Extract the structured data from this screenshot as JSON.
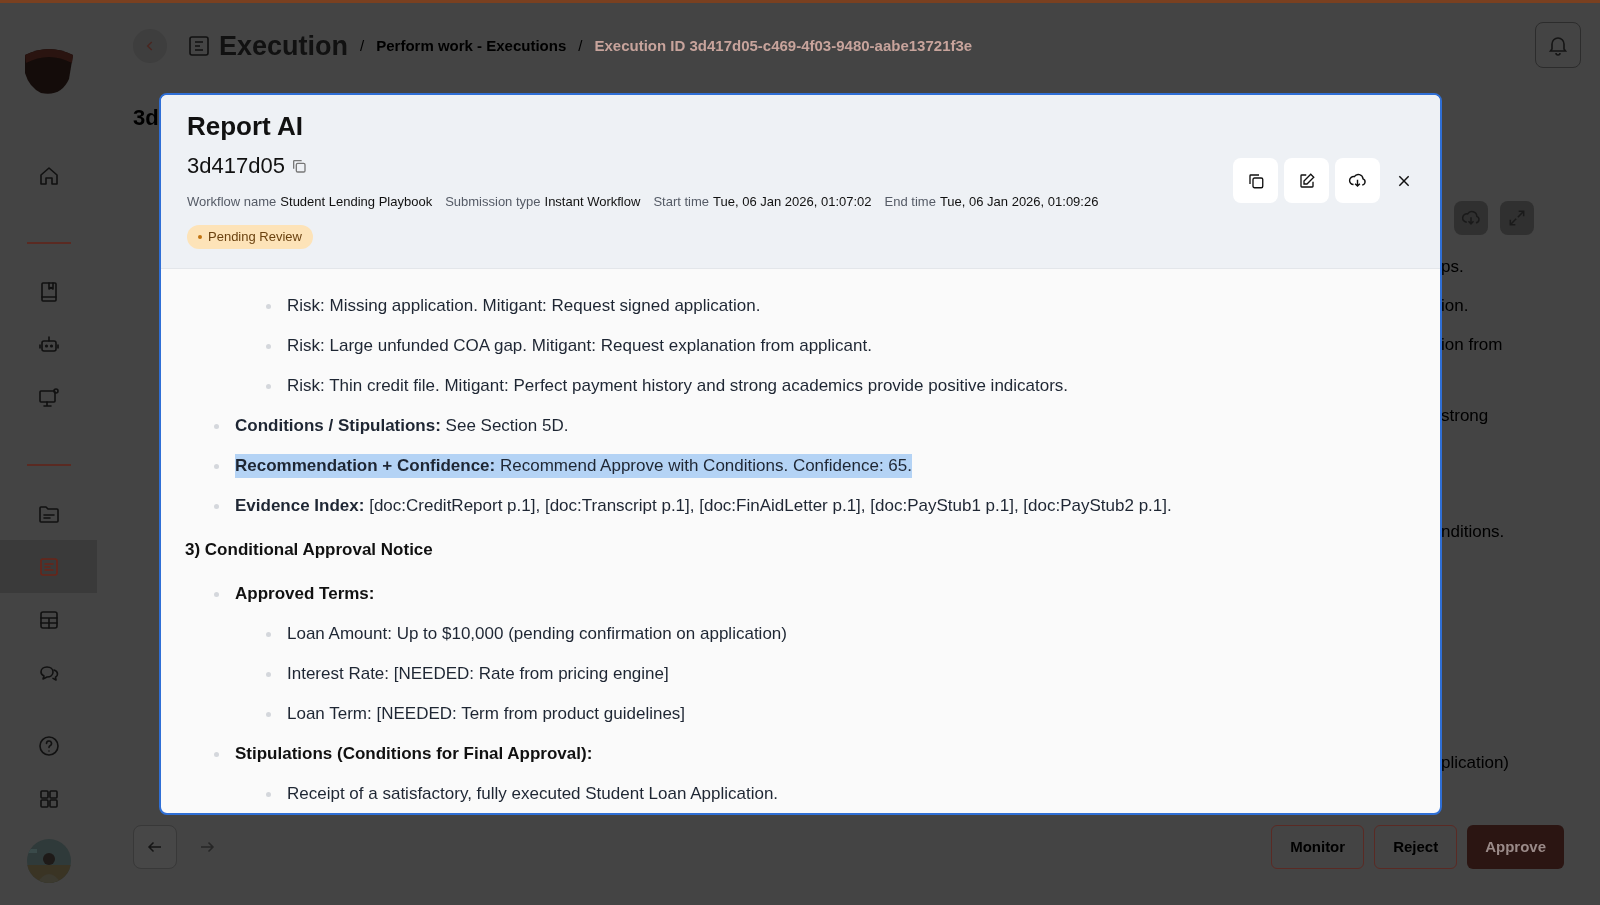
{
  "sidebar": {
    "items": [
      {
        "selected": false
      },
      {
        "selected": false
      },
      {
        "selected": false
      },
      {
        "selected": false
      },
      {
        "selected": false
      },
      {
        "selected": true
      },
      {
        "selected": false
      },
      {
        "selected": false
      },
      {
        "selected": false
      },
      {
        "selected": false
      }
    ]
  },
  "breadcrumb": {
    "title": "Execution",
    "separator": "/",
    "items": [
      {
        "text": "Perform work - Executions",
        "current": false
      },
      {
        "text": "Execution ID 3d417d05-c469-4f03-9480-aabe13721f3e",
        "current": true
      }
    ]
  },
  "background": {
    "left_fragment": "3d",
    "right_fragments": [
      "ps.",
      "ion.",
      "ion from",
      "strong",
      "nditions.",
      "plication)"
    ]
  },
  "footer": {
    "buttons": [
      {
        "label": "Monitor",
        "kind": "outline"
      },
      {
        "label": "Reject",
        "kind": "outline"
      },
      {
        "label": "Approve",
        "kind": "primary"
      }
    ]
  },
  "modal": {
    "title": "Report AI",
    "id": "3d417d05",
    "meta": [
      {
        "label": "Workflow name",
        "value": "Student Lending Playbook"
      },
      {
        "label": "Submission type",
        "value": "Instant Workflow"
      },
      {
        "label": "Start time",
        "value": "Tue, 06 Jan 2026, 01:07:02"
      },
      {
        "label": "End time",
        "value": "Tue, 06 Jan 2026, 01:09:26"
      }
    ],
    "status": {
      "text": "Pending Review",
      "color": "#c2730f"
    },
    "body": [
      {
        "kind": "list",
        "items": [
          {
            "kind": "continuation",
            "children": [
              {
                "text": "Risk: Missing application. Mitigant: Request signed application.",
                "highlighted": false
              },
              {
                "text": "Risk: Large unfunded COA gap. Mitigant: Request explanation from applicant.",
                "highlighted": false
              },
              {
                "text": "Risk: Thin credit file. Mitigant: Perfect payment history and strong academics provide positive indicators.",
                "highlighted": false
              }
            ]
          },
          {
            "kind": "entry",
            "text": "**Conditions / Stipulations:** See Section 5D.",
            "highlighted": false
          },
          {
            "kind": "entry",
            "text": "**Recommendation + Confidence:** Recommend Approve with Conditions. Confidence: 65.",
            "highlighted": true
          },
          {
            "kind": "entry",
            "text": "**Evidence Index:** [doc:CreditReport p.1], [doc:Transcript p.1], [doc:FinAidLetter p.1], [doc:PayStub1 p.1], [doc:PayStub2 p.1].",
            "highlighted": false
          }
        ]
      },
      {
        "kind": "heading",
        "text": "3) Conditional Approval Notice"
      },
      {
        "kind": "list",
        "items": [
          {
            "kind": "label",
            "text": "Approved Terms:",
            "highlighted": false,
            "children": [
              {
                "text": "Loan Amount: Up to $10,000 (pending confirmation on application)",
                "highlighted": false
              },
              {
                "text": "Interest Rate: [NEEDED: Rate from pricing engine]",
                "highlighted": false
              },
              {
                "text": "Loan Term: [NEEDED: Term from product guidelines]",
                "highlighted": false
              }
            ]
          },
          {
            "kind": "label",
            "text": "Stipulations (Conditions for Final Approval):",
            "highlighted": false,
            "children": [
              {
                "text": "Receipt of a satisfactory, fully executed Student Loan Application.",
                "highlighted": false
              }
            ]
          }
        ]
      }
    ]
  }
}
